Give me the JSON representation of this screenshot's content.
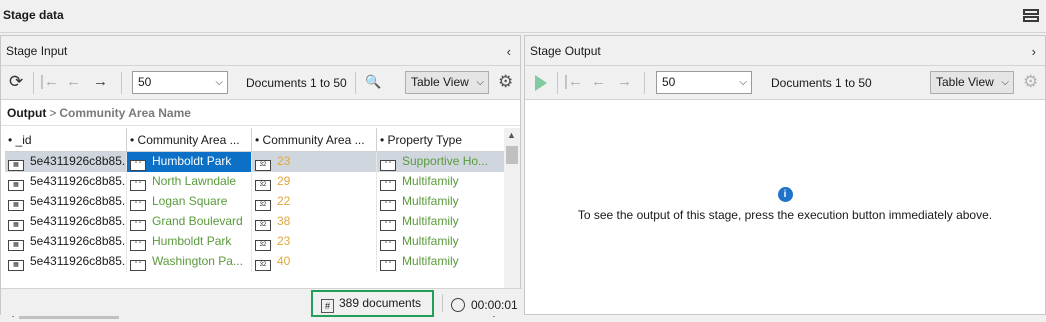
{
  "window": {
    "title": "Stage data"
  },
  "input_panel": {
    "title": "Stage Input",
    "page_size": "50",
    "range_text": "Documents 1 to 50",
    "view": "Table View",
    "breadcrumb": {
      "root": "Output",
      "path": "Community Area Name"
    },
    "columns": [
      "_id",
      "Community Area ...",
      "Community Area ...",
      "Property Type"
    ],
    "rows": [
      {
        "id": "5e4311926c8b85...",
        "area_name": "Humboldt Park",
        "area_num": "23",
        "property_type": "Supportive Ho..."
      },
      {
        "id": "5e4311926c8b85...",
        "area_name": "North Lawndale",
        "area_num": "29",
        "property_type": "Multifamily"
      },
      {
        "id": "5e4311926c8b85...",
        "area_name": "Logan Square",
        "area_num": "22",
        "property_type": "Multifamily"
      },
      {
        "id": "5e4311926c8b85...",
        "area_name": "Grand Boulevard",
        "area_num": "38",
        "property_type": "Multifamily"
      },
      {
        "id": "5e4311926c8b85...",
        "area_name": "Humboldt Park",
        "area_num": "23",
        "property_type": "Multifamily"
      },
      {
        "id": "5e4311926c8b85...",
        "area_name": "Washington Pa...",
        "area_num": "40",
        "property_type": "Multifamily"
      }
    ],
    "doc_count": "389 documents",
    "elapsed": "00:00:01"
  },
  "output_panel": {
    "title": "Stage Output",
    "page_size": "50",
    "range_text": "Documents 1 to 50",
    "view": "Table View",
    "info_message": "To see the output of this stage, press the execution button immediately above."
  },
  "colors": {
    "accent_green": "#22a05a",
    "selection": "#0c70c7",
    "string_value": "#5a9a3c",
    "number_value": "#e0a840",
    "info": "#1f73c9"
  }
}
